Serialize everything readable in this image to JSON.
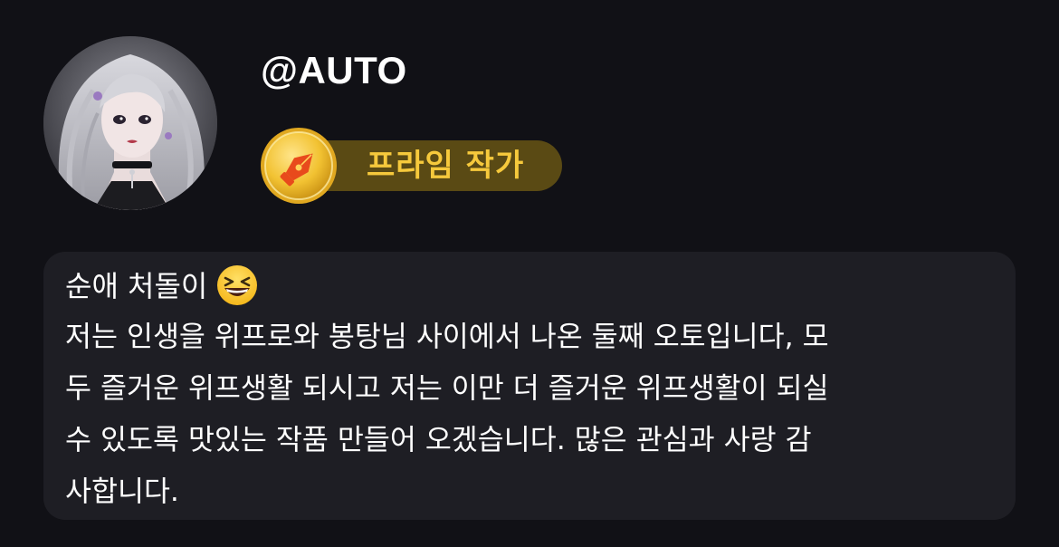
{
  "profile": {
    "username": "@AUTO",
    "avatar_alt": "avatar"
  },
  "badge": {
    "label": "프라임 작가",
    "icon": "pen-nib-coin-icon",
    "colors": {
      "pill": "#5a4a14",
      "text": "#f6c93c",
      "coin": "#f2c232"
    }
  },
  "bio": {
    "title": "순애 처돌이",
    "title_emoji": "grinning-squinting-face-icon",
    "body": "저는 인생을 위프로와 봉탕님 사이에서 나온 둘째 오토입니다, 모\n두 즐거운 위프생활 되시고 저는 이만 더 즐거운 위프생활이 되실\n수 있도록 맛있는 작품 만들어 오겠습니다. 많은 관심과 사랑 감\n사합니다."
  },
  "colors": {
    "background": "#111116",
    "card": "#1e1e24",
    "text": "#ffffff"
  }
}
